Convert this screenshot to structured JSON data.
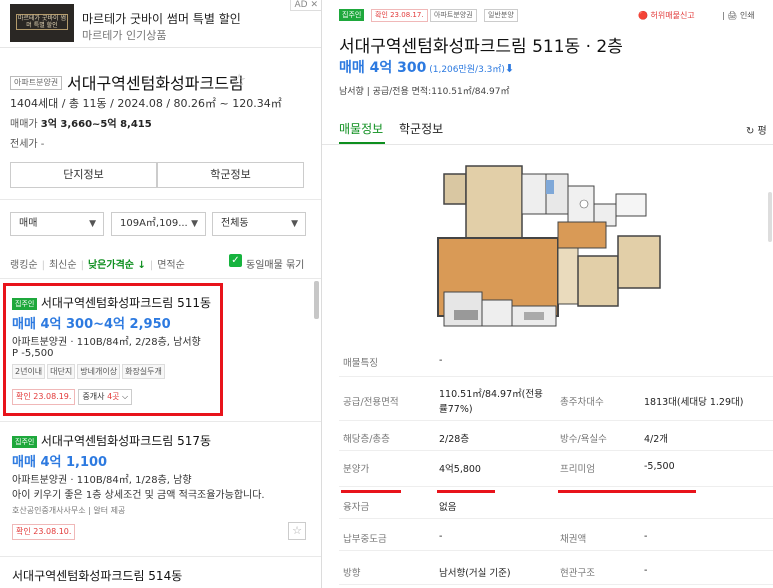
{
  "ad": {
    "thumb_text": "마르테가 굿바이 썸머 특별 할인",
    "title": "마르테가 굿바이 썸머 특별 할인",
    "subtitle": "마르테가 인기상품",
    "corner": "AD  ✕"
  },
  "complex": {
    "tag": "아파트분양권",
    "name": "서대구역센텀화성파크드림",
    "star": "☆",
    "meta": "1404세대 / 총 11동 / 2024.08 / 80.26㎡ ~ 120.34㎡",
    "sale_label": "매매가 ",
    "sale_value": "3억 3,660~5억 8,415",
    "rent_label": "전세가 -"
  },
  "buttons": {
    "complex_info": "단지정보",
    "school_info": "학군정보"
  },
  "filters": {
    "trade": "매매",
    "area": "109A㎡,109...",
    "dong": "전체동"
  },
  "sort": {
    "ranking": "랭킹순",
    "recent": "최신순",
    "low_price": "낮은가격순 ↓",
    "area": "면적순",
    "group_check": "✓",
    "group_label": "동일매물 묶기"
  },
  "listings": [
    {
      "badge": "집주인",
      "title": "서대구역센텀화성파크드림 511동",
      "price": "매매 4억 300~4억 2,950",
      "desc": "아파트분양권 · 110B/84㎡, 2/28층, 남서향",
      "premium": "P -5,500",
      "tags": [
        "2년이내",
        "대단지",
        "방네개이상",
        "화장실두개"
      ],
      "confirm": "확인 23.08.19.",
      "agent_pre": "중개사 ",
      "agent_count": "4곳",
      "agent_post": " ⌵"
    },
    {
      "badge": "집주인",
      "title": "서대구역센텀화성파크드림 517동",
      "price": "매매 4억 1,100",
      "desc": "아파트분양권 · 110B/84㎡, 1/28층, 남향",
      "memo": "아이 키우기 좋은 1층 상세조건 및 금액 적극조율가능합니다.",
      "provider": "호산공인중개사사무소 | 알터 제공",
      "confirm": "확인 23.08.10.",
      "star": "☆"
    },
    {
      "title": "서대구역센텀화성파크드림 514동"
    }
  ],
  "detail": {
    "badge": "집주인",
    "confirm": "확인 23.08.17.",
    "tag1": "아파트분양권",
    "tag2": "일반분양",
    "report": "🔴 허위매물신고",
    "print": "| 🖨 인쇄",
    "title": "서대구역센텀화성파크드림 511동 · 2층",
    "price": "매매 4억 300",
    "price_unit": " (1,206만원/3.3㎡)",
    "price_arrow": "⬇",
    "sub": "남서향 | 공급/전용 면적:110.51㎡/84.97㎡",
    "tab_listing": "매물정보",
    "tab_school": "학군정보",
    "refresh": "↻ 평"
  },
  "info_rows": [
    {
      "k1": "매물특징",
      "v1": "-"
    },
    {
      "k1": "공급/전용면적",
      "v1a": "110.51㎡/84.97㎡(전용",
      "v1b": "률77%)",
      "k2": "총주차대수",
      "v2": "1813대(세대당 1.29대)"
    },
    {
      "k1": "해당층/총층",
      "v1": "2/28층",
      "k2": "방수/욕실수",
      "v2": "4/2개"
    },
    {
      "k1": "분양가",
      "v1": "4억5,800",
      "k2": "프리미엄",
      "v2": "-5,500"
    },
    {
      "k1": "융자금",
      "v1": "없음"
    },
    {
      "k1": "납부중도금",
      "v1": "-",
      "k2": "채권액",
      "v2": "-"
    },
    {
      "k1": "방향",
      "v1": "남서향(거실 기준)",
      "k2": "현관구조",
      "v2": "-"
    }
  ],
  "colors": {
    "accent_green": "#0e8f1f",
    "price_blue": "#2d7ae0",
    "highlight_red": "#e8131b"
  }
}
